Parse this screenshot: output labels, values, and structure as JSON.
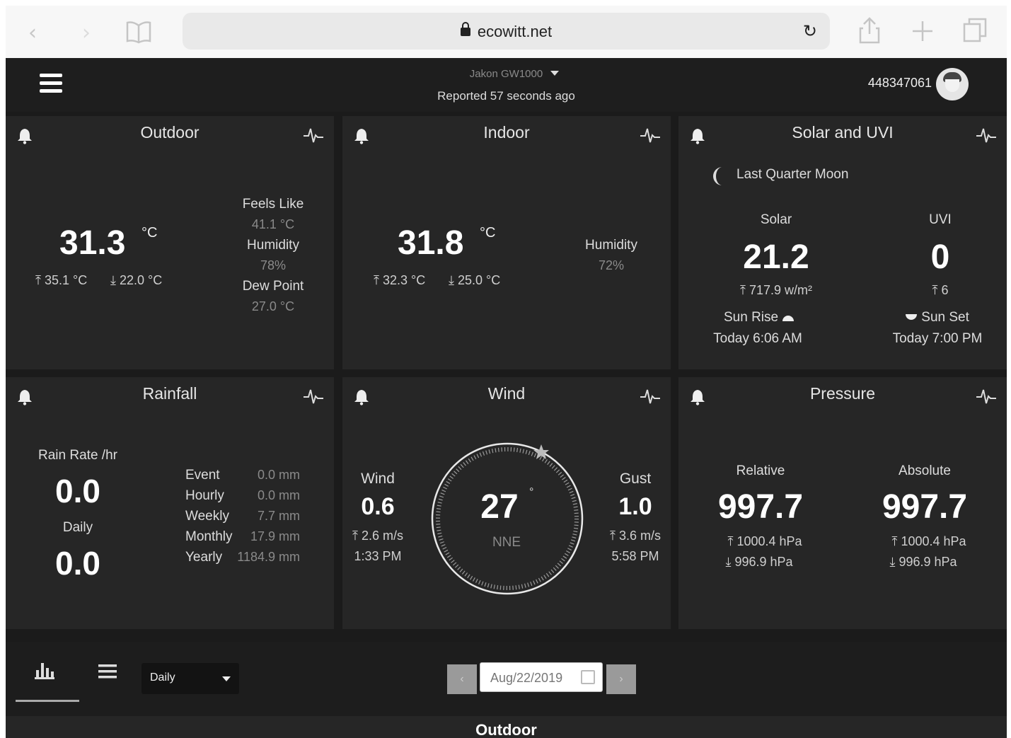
{
  "browser": {
    "url": "ecowitt.net",
    "back": "‹",
    "forward": "›"
  },
  "header": {
    "device_name": "Jakon GW1000",
    "reported": "Reported 57 seconds ago",
    "user_id": "448347061"
  },
  "outdoor": {
    "title": "Outdoor",
    "temp": "31.3",
    "unit": "°C",
    "high": "35.1 °C",
    "low": "22.0 °C",
    "feels_like_label": "Feels Like",
    "feels_like": "41.1 °C",
    "humidity_label": "Humidity",
    "humidity": "78%",
    "dew_point_label": "Dew Point",
    "dew_point": "27.0 °C"
  },
  "indoor": {
    "title": "Indoor",
    "temp": "31.8",
    "unit": "°C",
    "high": "32.3 °C",
    "low": "25.0 °C",
    "humidity_label": "Humidity",
    "humidity": "72%"
  },
  "solar": {
    "title": "Solar and UVI",
    "moon": "Last Quarter Moon",
    "solar_label": "Solar",
    "solar_value": "21.2",
    "solar_high": "717.9 w/m²",
    "uvi_label": "UVI",
    "uvi_value": "0",
    "uvi_high": "6",
    "sunrise_label": "Sun Rise",
    "sunrise": "Today 6:06 AM",
    "sunset_label": "Sun Set",
    "sunset": "Today 7:00 PM"
  },
  "rainfall": {
    "title": "Rainfall",
    "rate_label": "Rain Rate /hr",
    "rate": "0.0",
    "daily_label": "Daily",
    "daily": "0.0",
    "rows": [
      {
        "label": "Event",
        "value": "0.0 mm"
      },
      {
        "label": "Hourly",
        "value": "0.0 mm"
      },
      {
        "label": "Weekly",
        "value": "7.7 mm"
      },
      {
        "label": "Monthly",
        "value": "17.9 mm"
      },
      {
        "label": "Yearly",
        "value": "1184.9 mm"
      }
    ]
  },
  "wind": {
    "title": "Wind",
    "wind_label": "Wind",
    "wind_speed": "0.6",
    "wind_high": "2.6 m/s",
    "wind_time": "1:33 PM",
    "direction_deg": "27",
    "degree_symbol": "°",
    "direction": "NNE",
    "gust_label": "Gust",
    "gust_speed": "1.0",
    "gust_high": "3.6 m/s",
    "gust_time": "5:58 PM"
  },
  "pressure": {
    "title": "Pressure",
    "relative_label": "Relative",
    "relative": "997.7",
    "relative_high": "1000.4 hPa",
    "relative_low": "996.9 hPa",
    "absolute_label": "Absolute",
    "absolute": "997.7",
    "absolute_high": "1000.4 hPa",
    "absolute_low": "996.9 hPa"
  },
  "toolbar": {
    "period": "Daily",
    "date": "Aug/22/2019",
    "prev": "‹",
    "next": "›"
  },
  "section": {
    "title": "Outdoor"
  },
  "icons": {
    "max_arrow": "⤒",
    "min_arrow": "⤓"
  }
}
